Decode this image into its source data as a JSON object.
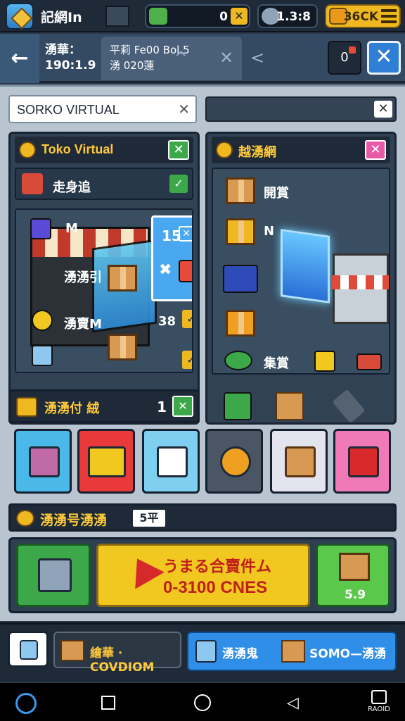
{
  "topbar": {
    "title": "記網In",
    "res_green_value": "0",
    "res_gear_value": "1.3:8",
    "res_gold_value": "36CK",
    "plus": "✕"
  },
  "header": {
    "back_label": "←",
    "name_line1": "湧華：",
    "name_line2": "190:1.9",
    "tab_line1": "平莉 Fe00 Bol.5",
    "tab_line2": "湧 020蓮",
    "tab_chevron": "^",
    "tab_close": "✕",
    "prev": "<",
    "icon_label": "0",
    "close_label": "✕"
  },
  "search": {
    "value": "SORKO VIRTUAL",
    "clear": "✕",
    "right_clear": "✕"
  },
  "left_panel": {
    "title": "Toko Virtual",
    "title_btn": "✕",
    "rows": [
      {
        "label": "走身追",
        "check": "✓"
      },
      {
        "label": "M",
        "number": "15",
        "check": "✕"
      },
      {
        "label": "湧湧引",
        "check": "✖"
      },
      {
        "label": "湧賣M",
        "number": "38",
        "check": "✓"
      }
    ],
    "bottom_check": "✓"
  },
  "right_panel": {
    "title": "越湧網",
    "title_btn": "✕",
    "rows": [
      {
        "label": "開賞"
      },
      {
        "label": "N"
      },
      {
        "label": "集賞"
      }
    ]
  },
  "strip": {
    "label": "湧湧付",
    "deco": "絨",
    "number": "1",
    "check": "✕"
  },
  "section2": {
    "label": "湧湧号湧湧",
    "badge": "5平"
  },
  "offers": {
    "middle_line1": "うまる合賣件ム",
    "middle_line2": "0-3100 CNES",
    "right_value": "5.9"
  },
  "bottom": {
    "btn2_label": "繪華 · COVDIOM",
    "btn3_label1": "湧湧鬼",
    "btn3_label2": "SOMO—湧湧"
  },
  "navbar": {
    "back": "◁",
    "menu_label": "RAOID"
  },
  "colors": {
    "accent_gold": "#f0b820",
    "accent_blue": "#2f7fd6",
    "accent_green": "#3da84a",
    "accent_red": "#d62a2a"
  },
  "icons": [
    "shop-icon",
    "box-icon",
    "coin-icon",
    "gear-icon",
    "basket-icon",
    "truck-icon",
    "bag-icon",
    "jar-icon",
    "case-icon"
  ]
}
